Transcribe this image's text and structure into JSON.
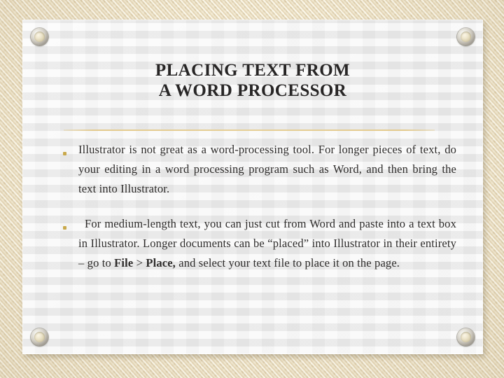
{
  "slide": {
    "title_line_1": "PLACING TEXT FROM",
    "title_line_2": "A WORD PROCESSOR",
    "bullets": [
      {
        "marker": "bullet-dot",
        "text": "Illustrator is not great as a word-processing tool. For longer pieces of text, do your editing in a word processing program such as Word, and then bring the text into Illustrator."
      },
      {
        "marker": "bullet-dot",
        "text_part_1": " For medium-length text, you can just cut from Word and paste into a text box in Illustrator. Longer documents can be “placed” into Illustrator in their entirety – go to ",
        "emphasis_1": "File",
        "separator": " > ",
        "emphasis_2": "Place,",
        "text_part_2": " and select your text file to place it on the page."
      }
    ]
  },
  "decor": {
    "rivet_top_left": "screw-rivet",
    "rivet_top_right": "screw-rivet",
    "rivet_bottom_left": "screw-rivet",
    "rivet_bottom_right": "screw-rivet",
    "divider": "gold-rule"
  },
  "colors": {
    "backdrop": "#ecdfc3",
    "board": "#ededed",
    "title_text": "#272525",
    "body_text": "#2e2c2b",
    "bullet_marker": "#c9a94c",
    "divider_gold": "#e3ca8d",
    "rivet_metal": "#cfcbc1"
  }
}
